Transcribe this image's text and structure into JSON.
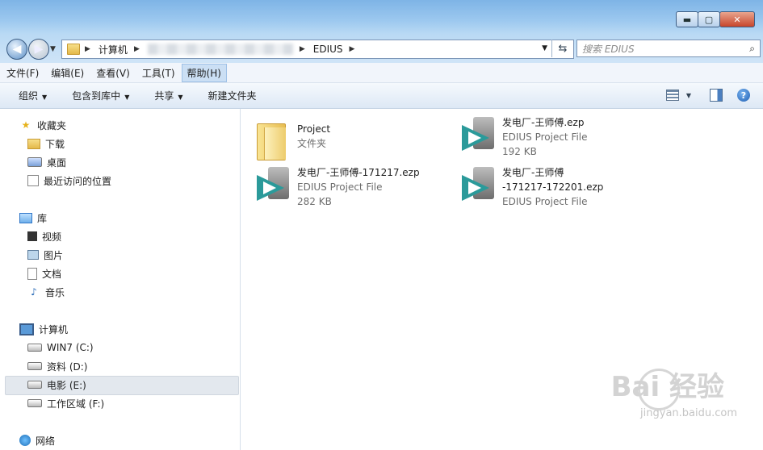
{
  "titlebar": {
    "min": "▬",
    "max": "▢",
    "close": "✕"
  },
  "address": {
    "crumbs": [
      "计算机",
      "EDIUS"
    ],
    "search_placeholder": "搜索 EDIUS"
  },
  "menus": [
    "文件(F)",
    "编辑(E)",
    "查看(V)",
    "工具(T)",
    "帮助(H)"
  ],
  "toolbar": {
    "organize": "组织",
    "include": "包含到库中",
    "share": "共享",
    "new_folder": "新建文件夹"
  },
  "sidebar": {
    "favorites": "收藏夹",
    "downloads": "下载",
    "desktop": "桌面",
    "recent": "最近访问的位置",
    "libraries": "库",
    "videos": "视频",
    "pictures": "图片",
    "documents": "文档",
    "music": "音乐",
    "computer": "计算机",
    "drive_c": "WIN7 (C:)",
    "drive_d": "资料 (D:)",
    "drive_e": "电影 (E:)",
    "drive_f": "工作区域 (F:)",
    "network": "网络"
  },
  "files": [
    {
      "name": "Project",
      "type": "文件夹",
      "size": ""
    },
    {
      "name": "发电厂-王师傅.ezp",
      "type": "EDIUS Project File",
      "size": "192 KB"
    },
    {
      "name": "发电厂-王师傅-171217.ezp",
      "type": "EDIUS Project File",
      "size": "282 KB"
    },
    {
      "name": "发电厂-王师傅",
      "name2": "-171217-172201.ezp",
      "type": "EDIUS Project File",
      "size": ""
    }
  ],
  "watermark": {
    "brand": "Bai  经验",
    "url": "jingyan.baidu.com"
  }
}
